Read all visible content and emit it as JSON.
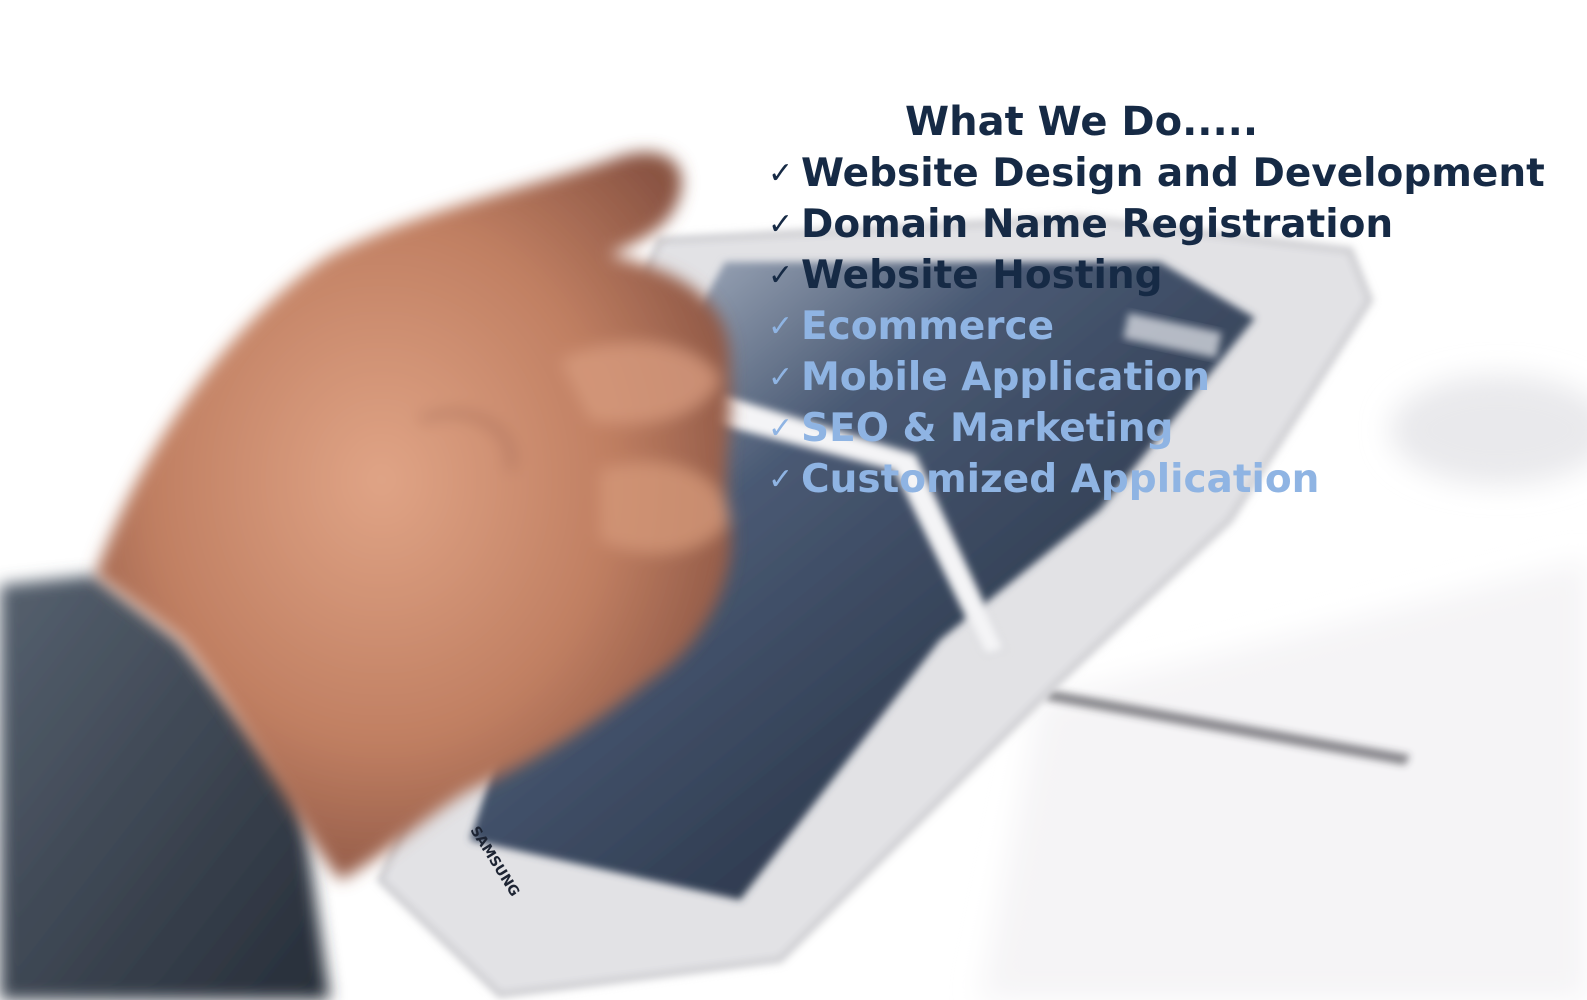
{
  "heading": {
    "text": "What We Do.....",
    "color": "#162a45"
  },
  "services": [
    {
      "label": "Website Design and Development",
      "color": "#162a45"
    },
    {
      "label": "Domain Name Registration",
      "color": "#162a45"
    },
    {
      "label": "Website Hosting",
      "color": "#162a45"
    },
    {
      "label": "Ecommerce",
      "color": "#8fb4e3"
    },
    {
      "label": "Mobile Application",
      "color": "#8fb4e3"
    },
    {
      "label": "SEO & Marketing",
      "color": "#8fb4e3"
    },
    {
      "label": "Customized Application",
      "color": "#8fb4e3"
    }
  ],
  "check_glyph": "✓",
  "tablet_brand": "SAMSUNG",
  "colors": {
    "background": "#ffffff",
    "sleeve": "#3b4656",
    "skin": "#c98a6c",
    "tablet_frame": "#e4e4e6",
    "tablet_screen": "#1d2a3e"
  }
}
